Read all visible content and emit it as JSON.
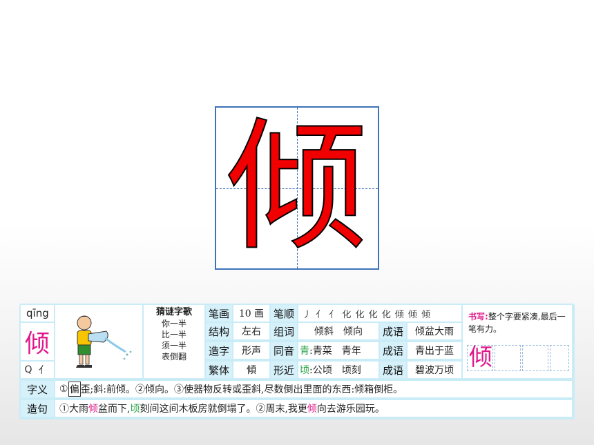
{
  "big_character": "倾",
  "card": {
    "pinyin": "qīng",
    "character": "倾",
    "q_letter": "Q",
    "q_radical": "亻",
    "riddle": {
      "title": "猜谜字歌",
      "lines": [
        "你一半",
        "比一半",
        "须一半",
        "表倒翻"
      ]
    },
    "stroke_count_label": "笔画",
    "stroke_count_value": "10 画",
    "stroke_order_label": "笔顺",
    "stroke_order_value": "丿 亻 亻 化 化 化 化 倾 倾 倾",
    "structure_label": "结构",
    "structure_value": "左右",
    "words_label": "组词",
    "words_value": "倾斜　倾向",
    "idiom_label": "成语",
    "idiom_1": "倾盆大雨",
    "formation_label": "造字",
    "formation_value": "形声",
    "homophone_label": "同音",
    "homophone_char": "青",
    "homophone_words": ":青菜　青年",
    "idiom_2": "青出于蓝",
    "traditional_label": "繁体",
    "traditional_value": "傾",
    "similar_label": "形近",
    "similar_char": "顷",
    "similar_words": ":公顷　顷刻",
    "idiom_3": "碧波万顷",
    "writing_tip_label": "书写:",
    "writing_tip_text": "整个字要紧凑,最后一笔有力。",
    "meaning_label": "字义",
    "meaning_text": "①",
    "meaning_boxed": "偏",
    "meaning_rest": "歪;斜:前倾。②倾向。③使器物反转或歪斜,尽数倒出里面的东西:倾箱倒柜。",
    "sentence_label": "造句",
    "sentence_p1": "①大雨",
    "sentence_hl1": "倾",
    "sentence_p2": "盆而下,",
    "sentence_hl2": "顷",
    "sentence_p3": "刻间这间木板房就倒塌了。②周末,我更",
    "sentence_hl3": "倾",
    "sentence_p4": "向去游乐园玩。"
  }
}
